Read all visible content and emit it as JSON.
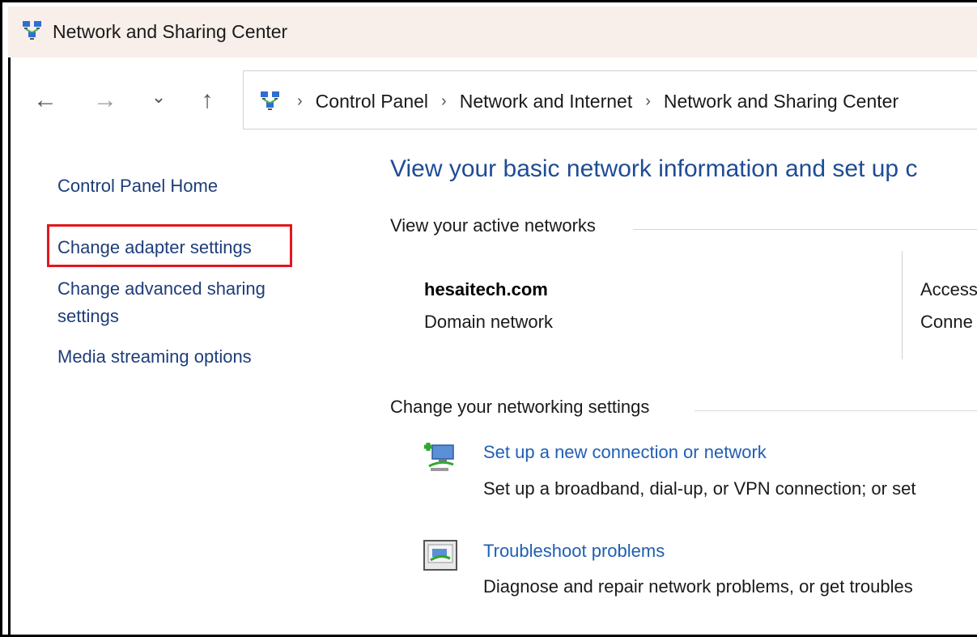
{
  "window": {
    "title": "Network and Sharing Center",
    "icon": "network-sharing-icon"
  },
  "nav": {
    "back": "←",
    "forward": "→",
    "recent": "⌄",
    "up": "↑"
  },
  "breadcrumb": {
    "separator": "›",
    "items": [
      "Control Panel",
      "Network and Internet",
      "Network and Sharing Center"
    ]
  },
  "sidebar": {
    "items": [
      {
        "label": "Control Panel Home"
      },
      {
        "label": "Change adapter settings"
      },
      {
        "label": "Change advanced sharing settings",
        "line1": "Change advanced sharing",
        "line2": "settings"
      },
      {
        "label": "Media streaming options"
      }
    ]
  },
  "main": {
    "title": "View your basic network information and set up c",
    "active_networks_heading": "View your active networks",
    "network": {
      "name": "hesaitech.com",
      "type": "Domain network",
      "access_label": "Access",
      "connections_label": "Conne"
    },
    "settings_heading": "Change your networking settings",
    "tasks": [
      {
        "icon": "new-connection-icon",
        "link": "Set up a new connection or network",
        "description": "Set up a broadband, dial-up, or VPN connection; or set"
      },
      {
        "icon": "troubleshoot-icon",
        "link": "Troubleshoot problems",
        "description": "Diagnose and repair network problems, or get troubles"
      }
    ]
  },
  "colors": {
    "title_bar": "#f8efea",
    "link": "#1e3d7a",
    "heading": "#1e4c96",
    "task_link": "#1f5fb4",
    "highlight": "#e3161c"
  }
}
